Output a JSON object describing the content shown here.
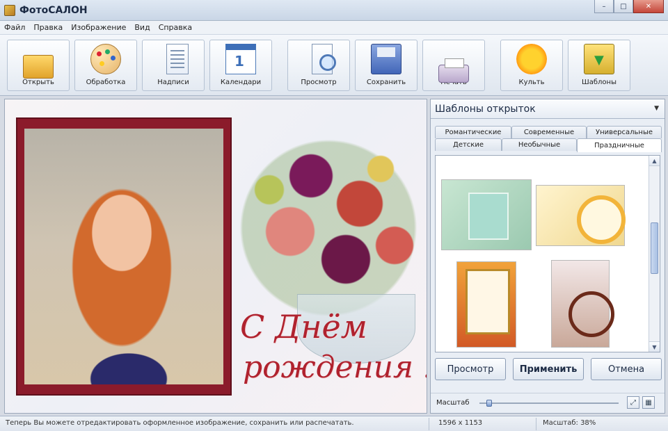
{
  "window": {
    "title": "ФотоСАЛОН",
    "controls": [
      "–",
      "□",
      "✕"
    ]
  },
  "menu": [
    "Файл",
    "Правка",
    "Изображение",
    "Вид",
    "Справка"
  ],
  "toolbar": [
    {
      "label": "Открыть",
      "icon": "folder-icon"
    },
    {
      "label": "Обработка",
      "icon": "palette-icon"
    },
    {
      "label": "Надписи",
      "icon": "text-document-icon"
    },
    {
      "label": "Календари",
      "icon": "calendar-icon"
    },
    {
      "label": "Просмотр",
      "icon": "magnifier-icon"
    },
    {
      "label": "Сохранить",
      "icon": "floppy-disk-icon"
    },
    {
      "label": "Печать",
      "icon": "printer-icon"
    },
    {
      "label": "Культь",
      "icon": "sun-icon"
    },
    {
      "label": "Шаблоны",
      "icon": "templates-icon"
    }
  ],
  "card": {
    "greeting_line1": "С Днём",
    "greeting_line2": "рождения !"
  },
  "panel": {
    "combo": "Шаблоны открыток",
    "tabs_row1": [
      "Романтические",
      "Современные",
      "Универсальные"
    ],
    "tabs_row2": [
      "Детские",
      "Необычные",
      "Праздничные"
    ],
    "active_tab": "Праздничные",
    "buttons": {
      "preview": "Просмотр",
      "apply": "Применить",
      "cancel": "Отмена"
    },
    "zoom_label": "Масштаб",
    "zoom_level": 0.05
  },
  "status": {
    "message": "Теперь Вы можете отредактировать оформленное изображение, сохранить или распечатать.",
    "size": "1596 x 1153",
    "zoom": "Масштаб: 38%"
  },
  "colors": {
    "frame": "#8b1b2b",
    "greeting": "#b0222e",
    "accent": "#3d6fb8"
  }
}
